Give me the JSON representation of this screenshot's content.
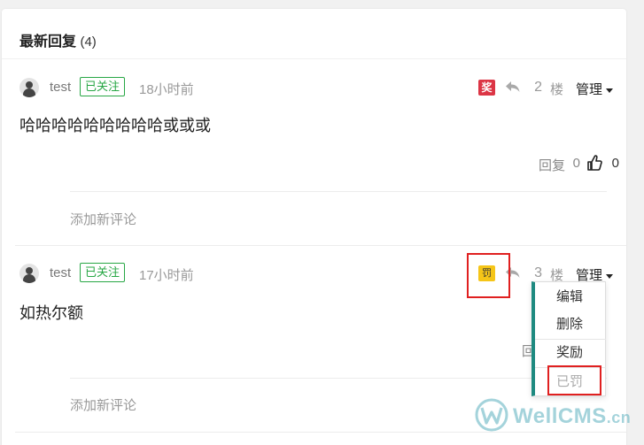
{
  "section": {
    "title": "最新回复",
    "count": "(4)"
  },
  "posts": [
    {
      "username": "test",
      "follow_badge": "已关注",
      "time": "18小时前",
      "tag": "奖",
      "floor_number": "2",
      "floor_label": "楼",
      "manage_label": "管理",
      "content": "哈哈哈哈哈哈哈哈哈或或或",
      "reply_label": "回复",
      "reply_count": "0",
      "like_count": "0",
      "add_comment": "添加新评论"
    },
    {
      "username": "test",
      "follow_badge": "已关注",
      "time": "17小时前",
      "tag": "罚",
      "floor_number": "3",
      "floor_label": "楼",
      "manage_label": "管理",
      "content": "如热尔额",
      "reply_label": "回",
      "add_comment": "添加新评论"
    }
  ],
  "manage_menu": {
    "items": [
      "编辑",
      "删除",
      "奖励",
      "已罚"
    ]
  },
  "watermark": {
    "brand": "WellCMS",
    "suffix": ".cn"
  },
  "colors": {
    "follow_green": "#28a745",
    "reward_red": "#dc3545",
    "penalty_yellow": "#f5c518",
    "menu_accent": "#1e8a80",
    "highlight_red": "#e02020"
  },
  "icons": {
    "reply": "reply-arrow-icon",
    "like": "thumbs-up-icon",
    "caret": "caret-down-icon",
    "avatar": "user-avatar-icon",
    "watermark_logo": "w-circle-logo-icon"
  }
}
